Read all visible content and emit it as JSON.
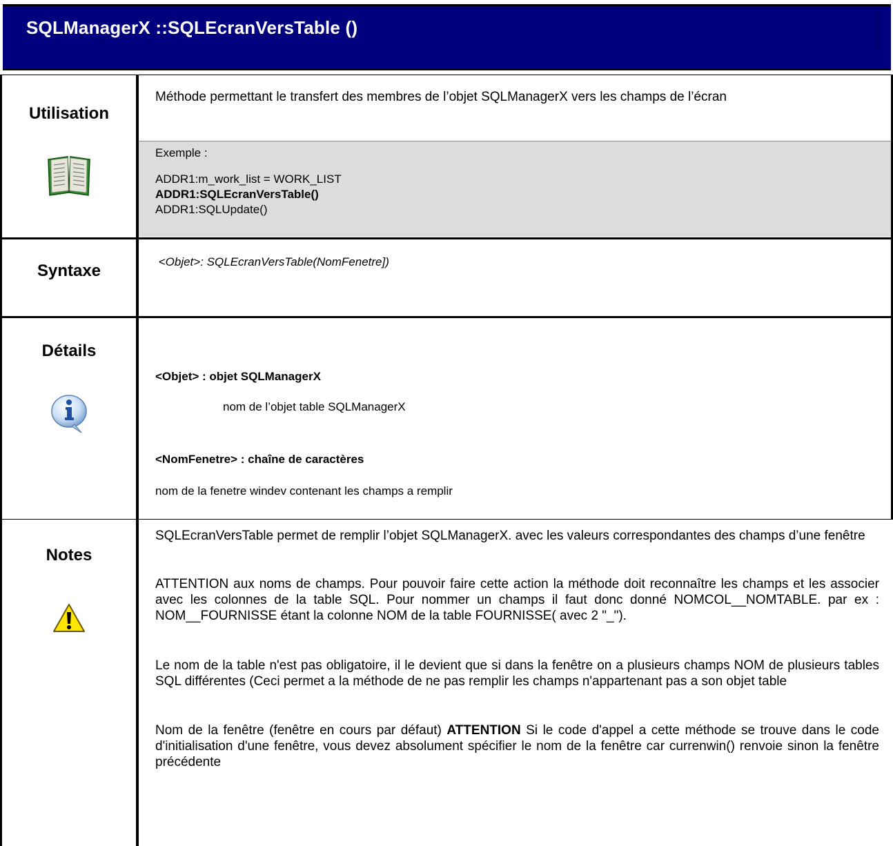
{
  "header": {
    "title": "SQLManagerX ::SQLEcranVersTable ()"
  },
  "utilisation": {
    "label": "Utilisation",
    "description": "Méthode permettant  le transfert des membres de l’objet SQLManagerX vers les champs de l’écran",
    "example_heading": "Exemple :",
    "example_lines": [
      "ADDR1:m_work_list = WORK_LIST",
      "ADDR1:SQLEcranVersTable()",
      "ADDR1:SQLUpdate()"
    ]
  },
  "syntaxe": {
    "label": "Syntaxe",
    "value": " <Objet>: SQLEcranVersTable(NomFenetre])"
  },
  "details": {
    "label": "Détails",
    "param1_title": "<Objet> : objet SQLManagerX",
    "param1_desc": "nom de l’objet table SQLManagerX",
    "param2_title": "<NomFenetre> : chaîne de caractères",
    "param2_desc": "nom de la fenetre windev contenant les champs a remplir"
  },
  "notes": {
    "label": "Notes",
    "p1": "SQLEcranVersTable permet de remplir l’objet SQLManagerX. avec les valeurs correspondantes des champs d’une fenêtre",
    "p2": "ATTENTION aux noms de champs. Pour pouvoir faire cette action la méthode doit reconnaître les champs et les associer avec les colonnes de la table SQL. Pour nommer un champs il faut donc donné NOMCOL__NOMTABLE. par ex : NOM__FOURNISSE étant la colonne NOM de la table FOURNISSE( avec 2 \"_\").",
    "p3": "Le nom de la table n'est pas obligatoire, il le devient que si dans la fenêtre on a plusieurs champs NOM de plusieurs tables SQL différentes (Ceci permet a la méthode de ne pas remplir les champs n'appartenant pas a son objet table",
    "p4_pre": "Nom de la fenêtre (fenêtre en cours par défaut) ",
    "p4_bold": "ATTENTION",
    "p4_post": " Si le code d'appel a cette méthode se trouve dans le code d'initialisation d'une fenêtre, vous devez absolument spécifier le nom de la fenêtre car currenwin() renvoie sinon la fenêtre précédente"
  },
  "icons": [
    "book-icon",
    "info-icon",
    "warning-icon"
  ]
}
